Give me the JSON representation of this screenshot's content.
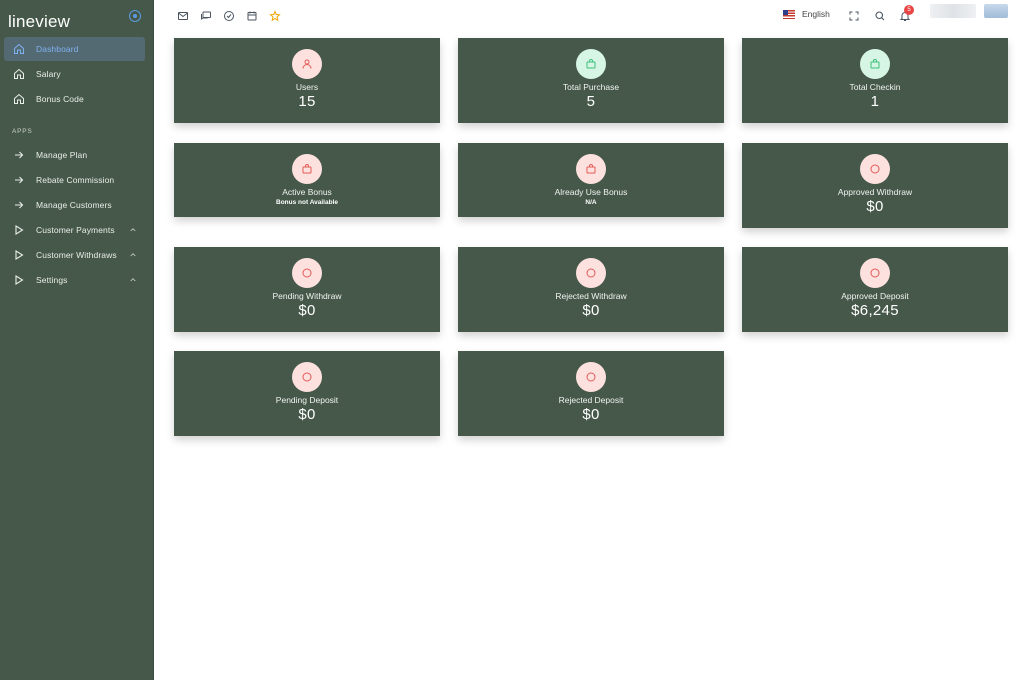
{
  "sidebar": {
    "brand": "lineview",
    "items_top": [
      {
        "label": "Dashboard",
        "icon": "home-icon",
        "active": true
      },
      {
        "label": "Salary",
        "icon": "home-icon"
      },
      {
        "label": "Bonus Code",
        "icon": "home-icon"
      }
    ],
    "section_label": "APPS",
    "items_apps": [
      {
        "label": "Manage Plan",
        "icon": "arrow-right-icon"
      },
      {
        "label": "Rebate Commission",
        "icon": "arrow-right-icon"
      },
      {
        "label": "Manage Customers",
        "icon": "arrow-right-icon"
      },
      {
        "label": "Customer Payments",
        "icon": "play-icon"
      },
      {
        "label": "Customer Withdraws",
        "icon": "play-icon"
      },
      {
        "label": "Settings",
        "icon": "play-icon"
      }
    ]
  },
  "topbar": {
    "language": "English",
    "notification_count": "5"
  },
  "colors": {
    "sidebar_bg": "#46584a",
    "card_bg": "#46584a",
    "accent_blue": "#5a9be0",
    "icon_pink_bg": "#fde1df",
    "icon_pink": "#e25a56",
    "icon_green_bg": "#d6f5e4",
    "icon_green": "#3cbf7a",
    "badge_red": "#e84545"
  },
  "cards": [
    {
      "label": "Users",
      "value": "15",
      "icon": "user-icon",
      "tone": "pink"
    },
    {
      "label": "Total Purchase",
      "value": "5",
      "icon": "bag-icon",
      "tone": "green"
    },
    {
      "label": "Total Checkin",
      "value": "1",
      "icon": "bag-icon",
      "tone": "green"
    },
    {
      "label": "Active Bonus",
      "sub": "Bonus not Available",
      "icon": "bag-icon",
      "tone": "pink"
    },
    {
      "label": "Already Use Bonus",
      "sub": "N/A",
      "icon": "bag-icon",
      "tone": "pink"
    },
    {
      "label": "Approved Withdraw",
      "value": "$0",
      "icon": "circle-icon",
      "tone": "pink"
    },
    {
      "label": "Pending Withdraw",
      "value": "$0",
      "icon": "circle-icon",
      "tone": "pink"
    },
    {
      "label": "Rejected Withdraw",
      "value": "$0",
      "icon": "circle-icon",
      "tone": "pink"
    },
    {
      "label": "Approved Deposit",
      "value": "$6,245",
      "icon": "circle-icon",
      "tone": "pink"
    },
    {
      "label": "Pending Deposit",
      "value": "$0",
      "icon": "circle-icon",
      "tone": "pink"
    },
    {
      "label": "Rejected Deposit",
      "value": "$0",
      "icon": "circle-icon",
      "tone": "pink"
    }
  ]
}
